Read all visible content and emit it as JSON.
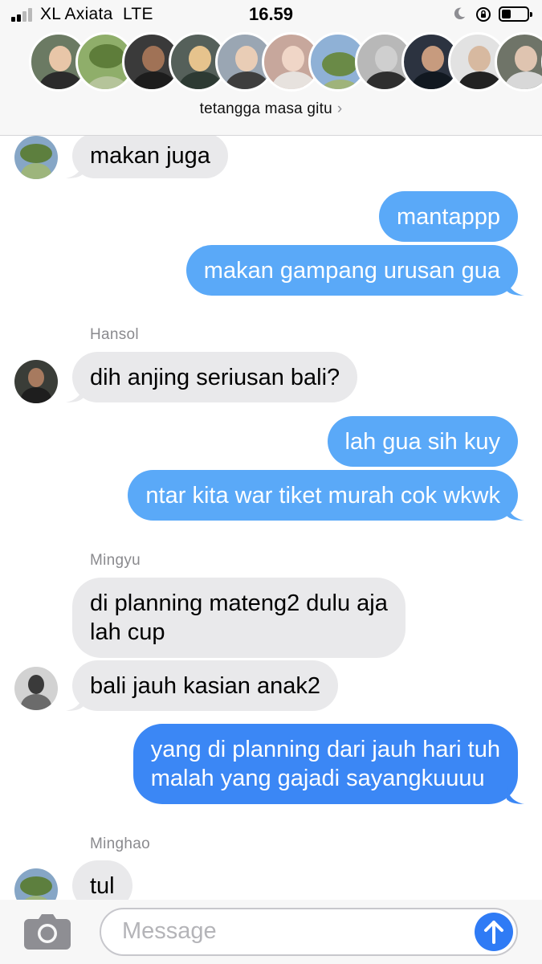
{
  "status_bar": {
    "carrier": "XL Axiata",
    "network": "LTE",
    "time": "16.59",
    "signal_bars": 2,
    "signal_bars_total": 4,
    "battery_level": 0.35
  },
  "header": {
    "group_name": "tetangga masa gitu",
    "chevron": "›",
    "avatar_count": 13
  },
  "messages": [
    {
      "type": "received",
      "text": "makan juga",
      "sender_avatar": "landscape-avatar"
    },
    {
      "type": "sent",
      "text": "mantappp"
    },
    {
      "type": "sent",
      "text": "makan gampang urusan gua"
    },
    {
      "type": "sender_name",
      "text": "Hansol"
    },
    {
      "type": "received",
      "text": "dih anjing seriusan bali?",
      "sender_avatar": "hansol-avatar"
    },
    {
      "type": "sent",
      "text": "lah gua sih kuy"
    },
    {
      "type": "sent",
      "text": "ntar kita war tiket murah cok wkwk"
    },
    {
      "type": "sender_name",
      "text": "Mingyu"
    },
    {
      "type": "received",
      "lines": [
        "di planning mateng2 dulu aja",
        "lah cup"
      ]
    },
    {
      "type": "received",
      "text": "bali jauh kasian anak2",
      "sender_avatar": "mingyu-avatar"
    },
    {
      "type": "sent",
      "lines": [
        "yang di planning dari jauh hari tuh",
        "malah yang gajadi sayangkuuuu"
      ]
    },
    {
      "type": "sender_name",
      "text": "Minghao"
    },
    {
      "type": "received",
      "text": "tul",
      "sender_avatar": "minghao-avatar"
    }
  ],
  "input_bar": {
    "placeholder": "Message",
    "camera_icon": "camera-icon",
    "send_icon": "arrow-up-icon"
  },
  "colors": {
    "sent_bubble": "#5aa9f8",
    "sent_bubble_latest": "#3b87f5",
    "received_bubble": "#e9e9eb",
    "send_button": "#2f7bf5"
  }
}
